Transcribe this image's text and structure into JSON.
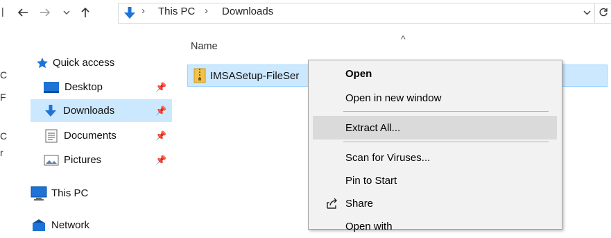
{
  "address_bar": {
    "breadcrumb": [
      "This PC",
      "Downloads"
    ],
    "separator": "›",
    "icons": [
      "back-arrow-icon",
      "forward-arrow-icon",
      "recent-chevron-icon",
      "up-arrow-icon",
      "download-arrow-icon",
      "dropdown-chevron-icon",
      "refresh-icon"
    ]
  },
  "nav_pane": {
    "items": [
      {
        "label": "Quick access",
        "icon": "star-icon"
      },
      {
        "label": "Desktop",
        "icon": "desktop-folder-icon",
        "pinned": true
      },
      {
        "label": "Downloads",
        "icon": "download-arrow-icon",
        "pinned": true,
        "selected": true
      },
      {
        "label": "Documents",
        "icon": "documents-folder-icon",
        "pinned": true
      },
      {
        "label": "Pictures",
        "icon": "pictures-folder-icon",
        "pinned": true
      },
      {
        "label": "This PC",
        "icon": "monitor-icon"
      },
      {
        "label": "Network",
        "icon": "network-icon"
      }
    ],
    "pin_glyph": "📌"
  },
  "file_list": {
    "column_name": "Name",
    "sort_glyph": "^",
    "file_name": "IMSASetup-FileSer",
    "file_icon": "zip-folder-icon"
  },
  "context_menu": {
    "items": [
      {
        "label": "Open",
        "bold": true
      },
      {
        "label": "Open in new window"
      },
      {
        "label": "Extract All...",
        "hover": true
      },
      {
        "label": "Scan for Viruses..."
      },
      {
        "label": "Pin to Start"
      },
      {
        "label": "Share",
        "icon": "share-icon"
      },
      {
        "label": "Open with"
      }
    ]
  },
  "colors": {
    "selection": "#cce8ff",
    "selection_border": "#99d1ff",
    "menu_bg": "#f2f2f2",
    "menu_hover": "#dadada",
    "accent_blue": "#1e73d6"
  }
}
